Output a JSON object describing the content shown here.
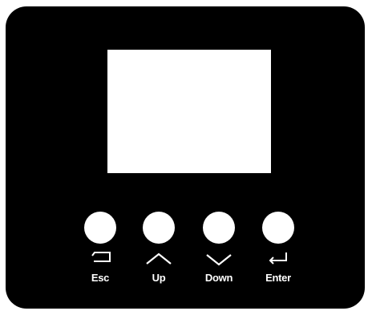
{
  "device": {
    "panel_color": "#000000",
    "screen_color": "#ffffff"
  },
  "buttons": [
    {
      "label": "Esc",
      "icon": "return-left-icon"
    },
    {
      "label": "Up",
      "icon": "chevron-up-icon"
    },
    {
      "label": "Down",
      "icon": "chevron-down-icon"
    },
    {
      "label": "Enter",
      "icon": "enter-icon"
    }
  ]
}
